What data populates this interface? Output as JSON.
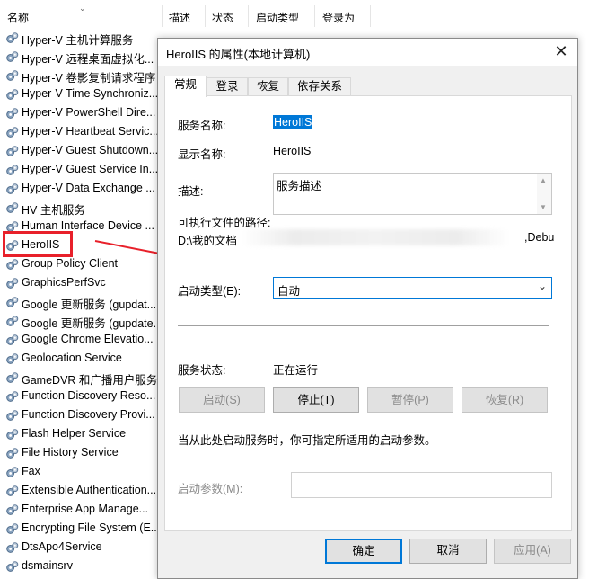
{
  "list_header": {
    "name_col": "名称",
    "desc_col": "描述",
    "status_col": "状态",
    "startup_col": "启动类型",
    "logon_col": "登录为"
  },
  "services": [
    "Hyper-V 主机计算服务",
    "Hyper-V 远程桌面虚拟化...",
    "Hyper-V 卷影复制请求程序",
    "Hyper-V Time Synchroniz...",
    "Hyper-V PowerShell Dire...",
    "Hyper-V Heartbeat Servic...",
    "Hyper-V Guest Shutdown...",
    "Hyper-V Guest Service In...",
    "Hyper-V Data Exchange ...",
    "HV 主机服务",
    "Human Interface Device ...",
    "HeroIIS",
    "Group Policy Client",
    "GraphicsPerfSvc",
    "Google 更新服务 (gupdat...",
    "Google 更新服务 (gupdate...",
    "Google Chrome Elevatio...",
    "Geolocation Service",
    "GameDVR 和广播用户服务...",
    "Function Discovery Reso...",
    "Function Discovery Provi...",
    "Flash Helper Service",
    "File History Service",
    "Fax",
    "Extensible Authentication...",
    "Enterprise App Manage...",
    "Encrypting File System (E...",
    "DtsApo4Service",
    "dsmainsrv"
  ],
  "dialog": {
    "title": "HeroIIS 的属性(本地计算机)",
    "close_glyph": "✕",
    "tabs": [
      "常规",
      "登录",
      "恢复",
      "依存关系"
    ],
    "general": {
      "service_name_label": "服务名称:",
      "service_name_value": "HeroIIS",
      "display_name_label": "显示名称:",
      "display_name_value": "HeroIIS",
      "description_label": "描述:",
      "description_value": "服务描述",
      "exe_path_label": "可执行文件的路径:",
      "exe_path_start": "D:\\我的文档",
      "exe_path_end": ",Debu",
      "startup_type_label": "启动类型(E):",
      "startup_type_value": "自动",
      "service_status_label": "服务状态:",
      "service_status_value": "正在运行",
      "start_button": "启动(S)",
      "stop_button": "停止(T)",
      "pause_button": "暂停(P)",
      "resume_button": "恢复(R)",
      "hint_text": "当从此处启动服务时，你可指定所适用的启动参数。",
      "start_params_label": "启动参数(M):",
      "start_params_value": ""
    },
    "ok_button": "确定",
    "cancel_button": "取消",
    "apply_button": "应用(A)"
  },
  "colors": {
    "selection_blue": "#0078d7",
    "highlight_red": "#e8202a"
  },
  "icons": {
    "service": "gear-icon",
    "sort": "chevron-down-icon",
    "close": "close-icon",
    "dropdown": "chevron-down-icon"
  }
}
